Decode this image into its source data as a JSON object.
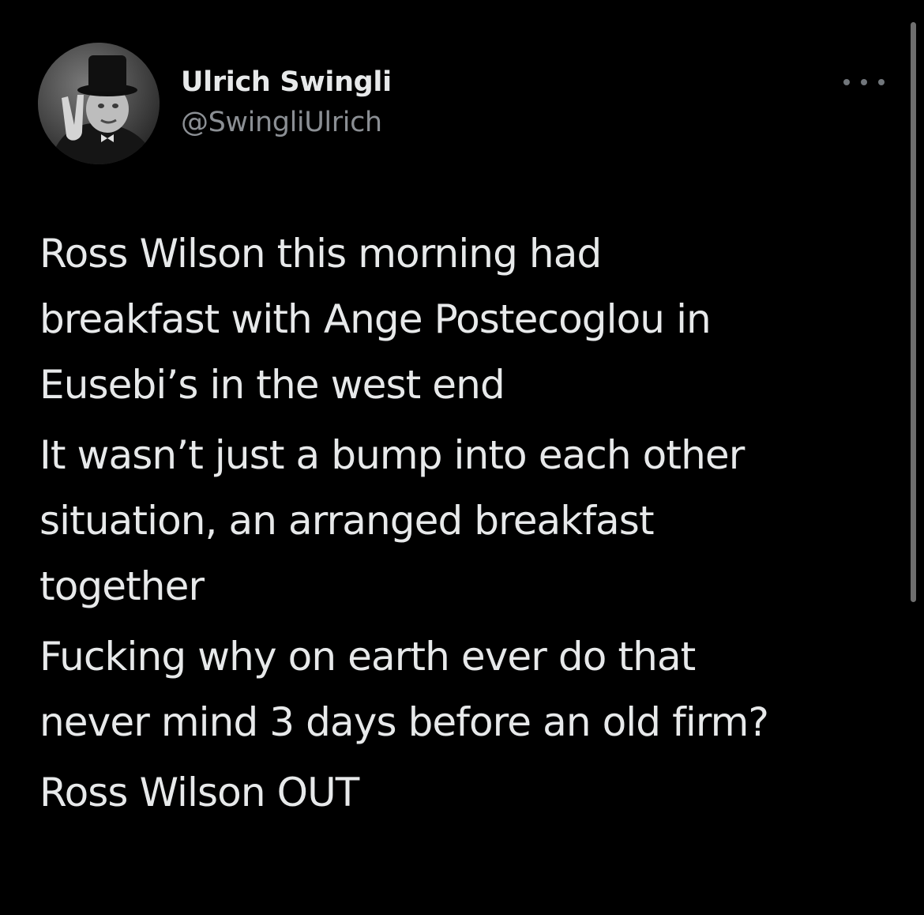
{
  "tweet": {
    "author": {
      "display_name": "Ulrich Swingli",
      "handle": "@SwingliUlrich",
      "avatar_icon": "profile-photo"
    },
    "more_icon": "more-horizontal-icon",
    "paragraphs": [
      "Ross Wilson this morning had\nbreakfast with Ange Postecoglou in\nEusebi’s in the west end",
      "It wasn’t just a bump into each other\nsituation, an arranged breakfast\ntogether",
      "Fucking why on earth ever do that\nnever mind 3 days before an old firm?",
      "Ross Wilson OUT"
    ]
  },
  "colors": {
    "background": "#000000",
    "primary_text": "#e7e9ea",
    "secondary_text": "#8b8f94",
    "icon_gray": "#71767b",
    "scrollbar": "#6f6f6f"
  }
}
